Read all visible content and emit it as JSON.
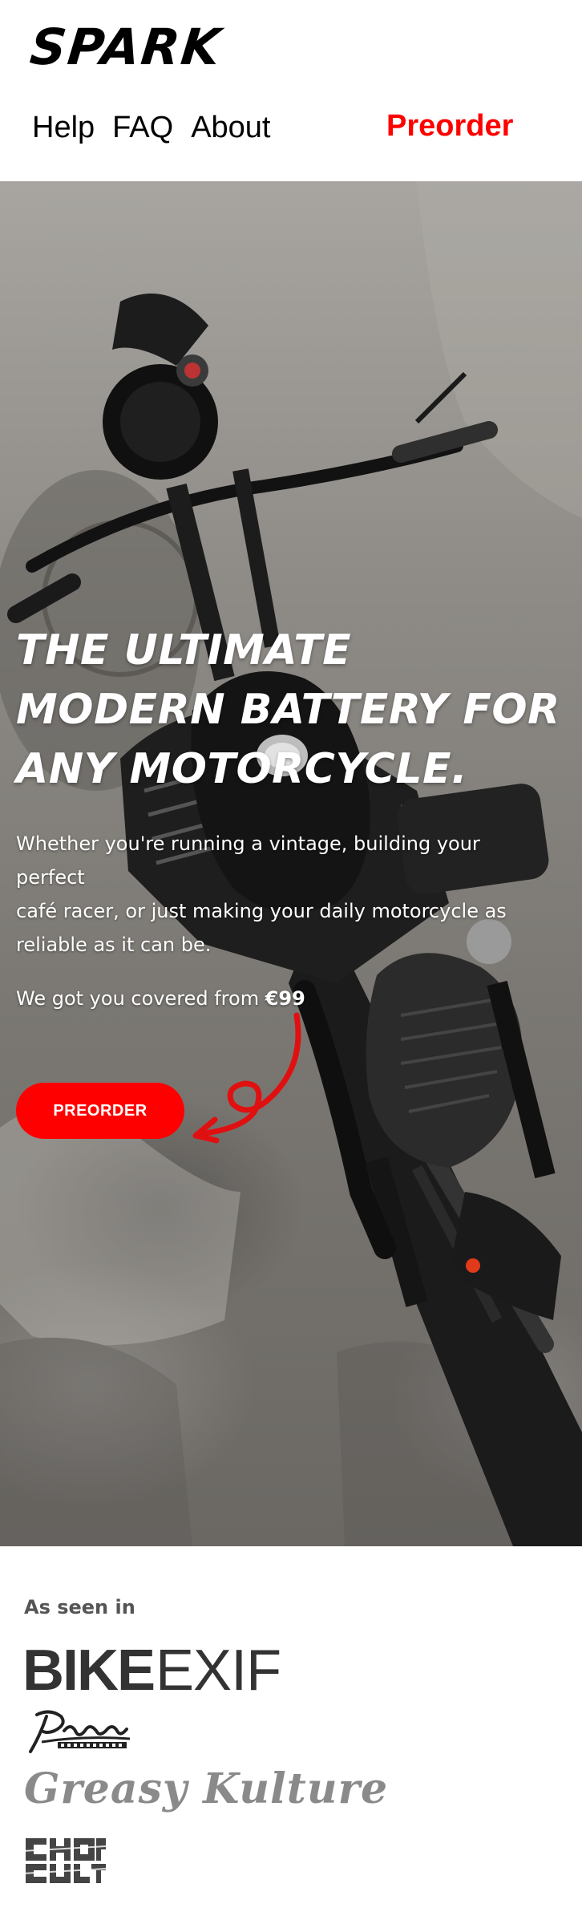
{
  "header": {
    "logo": "SPARK",
    "nav": [
      {
        "label": "Help"
      },
      {
        "label": "FAQ"
      },
      {
        "label": "About"
      }
    ],
    "preorder_label": "Preorder"
  },
  "hero": {
    "title_lines": [
      "THE ULTIMATE",
      "MODERN BATTERY FOR",
      "ANY MOTORCYCLE."
    ],
    "body_lines": [
      "Whether you're running a vintage, building your perfect",
      "café racer, or just making your daily motorcycle as reliable as it can be."
    ],
    "price_prefix": "We got you covered from",
    "price": "€99",
    "cta_label": "PREORDER"
  },
  "seen_in": {
    "title": "As seen in",
    "logos": [
      {
        "name": "BIKEEXIF",
        "part1": "BIKE",
        "part2": "EXIF"
      },
      {
        "name": "Pipeburn"
      },
      {
        "name": "Greasy Kulture",
        "text": "Greasy Kulture"
      },
      {
        "name": "Chop Cult"
      }
    ]
  },
  "colors": {
    "accent": "#ff0000",
    "text": "#000000",
    "hero_text": "#ffffff"
  }
}
